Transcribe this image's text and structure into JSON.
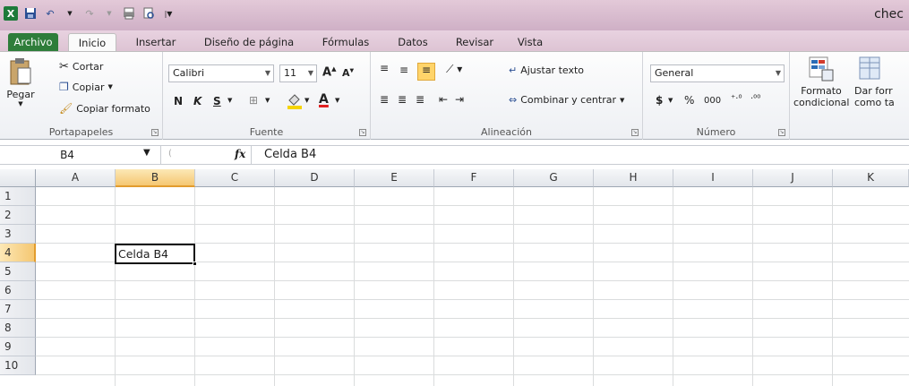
{
  "window": {
    "title": "chec"
  },
  "qat": [
    "excel-logo",
    "save-icon",
    "undo-icon",
    "redo-icon",
    "print-preview-icon",
    "quick-print-icon"
  ],
  "tabs": [
    {
      "label": "Archivo"
    },
    {
      "label": "Inicio"
    },
    {
      "label": "Insertar"
    },
    {
      "label": "Diseño de página"
    },
    {
      "label": "Fórmulas"
    },
    {
      "label": "Datos"
    },
    {
      "label": "Revisar"
    },
    {
      "label": "Vista"
    }
  ],
  "ribbon": {
    "clipboard": {
      "label": "Portapapeles",
      "paste": "Pegar",
      "cut": "Cortar",
      "copy": "Copiar",
      "format_painter": "Copiar formato"
    },
    "font": {
      "label": "Fuente",
      "name": "Calibri",
      "size": "11",
      "bold": "N",
      "italic": "K",
      "underline": "S"
    },
    "alignment": {
      "label": "Alineación",
      "wrap": "Ajustar texto",
      "merge": "Combinar y centrar"
    },
    "number": {
      "label": "Número",
      "format": "General",
      "currency": "$",
      "percent": "%",
      "thousands": "000"
    },
    "styles": {
      "cond_format_1": "Formato",
      "cond_format_2": "condicional",
      "table_format_1": "Dar forr",
      "table_format_2": "como ta"
    }
  },
  "formula_bar": {
    "name_box": "B4",
    "fx": "fx",
    "value": "Celda B4"
  },
  "columns": [
    "A",
    "B",
    "C",
    "D",
    "E",
    "F",
    "G",
    "H",
    "I",
    "J",
    "K"
  ],
  "rows": [
    "1",
    "2",
    "3",
    "4",
    "5",
    "6",
    "7",
    "8",
    "9",
    "10"
  ],
  "active_cell": {
    "ref": "B4",
    "value": "Celda B4",
    "column": "B",
    "row": "4"
  },
  "colors": {
    "selection_header": "#f5c772",
    "file_tab": "#2e7d3a",
    "titlebar": "#cfb0c6"
  }
}
